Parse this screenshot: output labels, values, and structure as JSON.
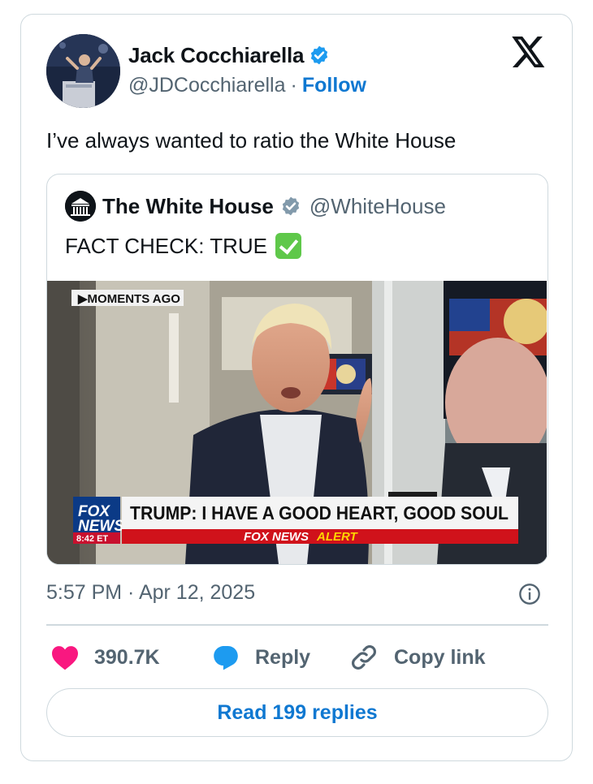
{
  "author": {
    "name": "Jack Cocchiarella",
    "handle": "@JDCocchiarella",
    "separator": "·",
    "follow_label": "Follow"
  },
  "tweet": {
    "text": "I’ve always wanted to ratio the White House",
    "timestamp": "5:57 PM · Apr 12, 2025"
  },
  "quoted": {
    "name": "The White House",
    "handle": "@WhiteHouse",
    "text": "FACT CHECK: TRUE",
    "media": {
      "tag": "▶MOMENTS AGO",
      "headline": "TRUMP: I HAVE A GOOD HEART, GOOD SOUL",
      "alert_brand": "FOX NEWS",
      "alert_word": "ALERT",
      "logo_line1": "FOX",
      "logo_line2": "NEWS",
      "time": "8:42 ET"
    }
  },
  "actions": {
    "like_count": "390.7K",
    "reply_label": "Reply",
    "copy_label": "Copy link"
  },
  "read_replies_label": "Read 199 replies",
  "colors": {
    "accent": "#0f78d1",
    "like": "#f91880",
    "reply_icon": "#1d9bf0",
    "border": "#cfd9de",
    "muted": "#536471"
  }
}
